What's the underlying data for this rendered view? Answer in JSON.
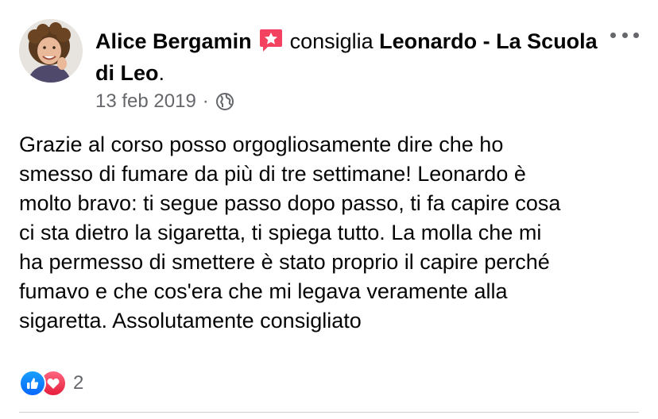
{
  "post": {
    "author_name": "Alice Bergamin",
    "badge_icon": "recommendation-star-icon",
    "recommends_text": "consiglia",
    "page_name": "Leonardo - La Scuola di Leo",
    "page_suffix": ".",
    "date": "13 feb 2019",
    "separator": "·",
    "privacy_icon": "globe-icon",
    "more_icon": "more-options-icon",
    "body": "Grazie al corso posso orgogliosamente dire che ho\nsmesso di fumare da più di tre settimane! Leonardo è\nmolto bravo: ti segue passo dopo passo, ti fa capire cosa\nci sta dietro la sigaretta, ti spiega tutto. La molla che mi\nha permesso di smettere è stato proprio il capire perché\nfumavo e che cos'era che mi legava veramente alla\nsigaretta. Assolutamente consigliato"
  },
  "reactions": {
    "icons": [
      "like-icon",
      "love-icon"
    ],
    "count": "2"
  },
  "colors": {
    "text": "#050505",
    "secondary": "#65676b",
    "badge": "#f3425f",
    "like": "#0866ff",
    "love": "#e61e3c",
    "divider": "#ced0d4"
  }
}
